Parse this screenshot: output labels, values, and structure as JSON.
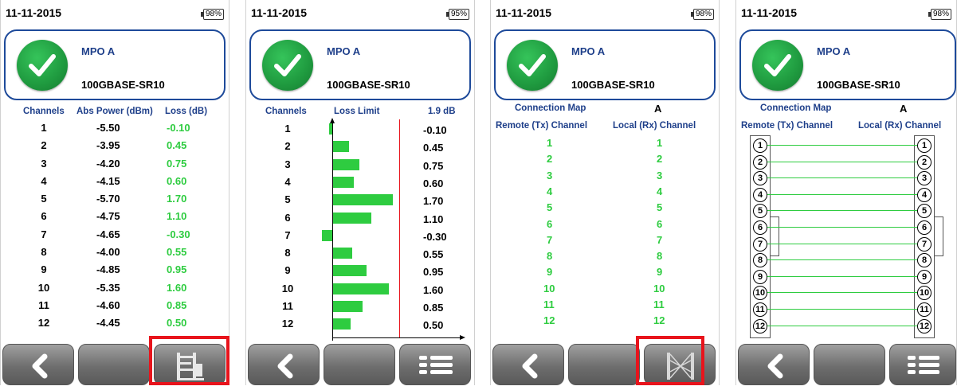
{
  "panels": [
    {
      "date": "11-11-2015",
      "battery": "98%",
      "connector": "MPO A",
      "standard": "100GBASE-SR10"
    },
    {
      "date": "11-11-2015",
      "battery": "95%",
      "connector": "MPO A",
      "standard": "100GBASE-SR10"
    },
    {
      "date": "11-11-2015",
      "battery": "98%",
      "connector": "MPO A",
      "standard": "100GBASE-SR10"
    },
    {
      "date": "11-11-2015",
      "battery": "98%",
      "connector": "MPO A",
      "standard": "100GBASE-SR10"
    }
  ],
  "table": {
    "headers": [
      "Channels",
      "Abs Power (dBm)",
      "Loss (dB)"
    ],
    "rows": [
      {
        "ch": "1",
        "power": "-5.50",
        "loss": "-0.10"
      },
      {
        "ch": "2",
        "power": "-3.95",
        "loss": "0.45"
      },
      {
        "ch": "3",
        "power": "-4.20",
        "loss": "0.75"
      },
      {
        "ch": "4",
        "power": "-4.15",
        "loss": "0.60"
      },
      {
        "ch": "5",
        "power": "-5.70",
        "loss": "1.70"
      },
      {
        "ch": "6",
        "power": "-4.75",
        "loss": "1.10"
      },
      {
        "ch": "7",
        "power": "-4.65",
        "loss": "-0.30"
      },
      {
        "ch": "8",
        "power": "-4.00",
        "loss": "0.55"
      },
      {
        "ch": "9",
        "power": "-4.85",
        "loss": "0.95"
      },
      {
        "ch": "10",
        "power": "-5.35",
        "loss": "1.60"
      },
      {
        "ch": "11",
        "power": "-4.60",
        "loss": "0.85"
      },
      {
        "ch": "12",
        "power": "-4.45",
        "loss": "0.50"
      }
    ]
  },
  "chart_data": {
    "type": "bar",
    "title": "",
    "column_headers": [
      "Channels",
      "Loss Limit",
      "1.9 dB"
    ],
    "limit_db": 1.9,
    "categories": [
      "1",
      "2",
      "3",
      "4",
      "5",
      "6",
      "7",
      "8",
      "9",
      "10",
      "11",
      "12"
    ],
    "values": [
      -0.1,
      0.45,
      0.75,
      0.6,
      1.7,
      1.1,
      -0.3,
      0.55,
      0.95,
      1.6,
      0.85,
      0.5
    ],
    "value_labels": [
      "-0.10",
      "0.45",
      "0.75",
      "0.60",
      "1.70",
      "1.10",
      "-0.30",
      "0.55",
      "0.95",
      "1.60",
      "0.85",
      "0.50"
    ],
    "bar_color": "#2ecc40",
    "limit_color": "#e8141c"
  },
  "map": {
    "title": "Connection Map",
    "side": "A",
    "remote_header": "Remote (Tx) Channel",
    "local_header": "Local (Rx) Channel",
    "remote": [
      "1",
      "2",
      "3",
      "4",
      "5",
      "6",
      "7",
      "8",
      "9",
      "10",
      "11",
      "12"
    ],
    "local": [
      "1",
      "2",
      "3",
      "4",
      "5",
      "6",
      "7",
      "8",
      "9",
      "10",
      "11",
      "12"
    ]
  },
  "toolbar": {
    "back_icon": "chevron-left-icon",
    "p1_right_icon": "graph-view-icon",
    "p2_right_icon": "list-view-icon",
    "p3_right_icon": "connector-diagram-icon",
    "p4_right_icon": "list-view-icon"
  },
  "colors": {
    "accent": "#1e3f8a",
    "pass": "#2ecc40",
    "highlight": "#e8141c"
  }
}
